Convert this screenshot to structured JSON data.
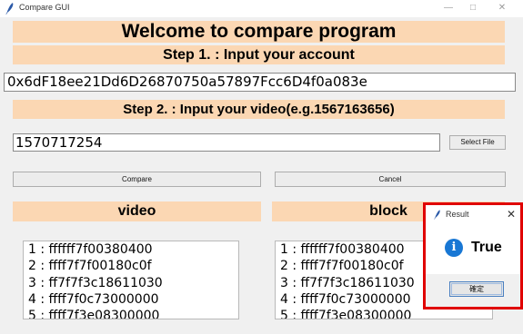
{
  "window": {
    "title": "Compare GUI"
  },
  "header": {
    "heading": "Welcome to compare program"
  },
  "step1": {
    "label": "Step 1. : Input your account",
    "account_value": "0x6dF18ee21Dd6D26870750a57897Fcc6D4f0a083e"
  },
  "step2": {
    "label": "Step 2. : Input your video(e.g.1567163656)",
    "video_value": "1570717254",
    "select_file_label": "Select File"
  },
  "actions": {
    "compare_label": "Compare",
    "cancel_label": "Cancel"
  },
  "columns": {
    "video_label": "video",
    "block_label": "block"
  },
  "video_list": [
    "1 : ffffff7f00380400",
    "2 : ffff7f7f00180c0f",
    "3 : ff7f7f3c18611030",
    "4 : ffff7f0c73000000",
    "5 : ffff7f3e08300000"
  ],
  "block_list": [
    "1 : ffffff7f00380400",
    "2 : ffff7f7f00180c0f",
    "3 : ff7f7f3c18611030",
    "4 : ffff7f0c73000000",
    "5 : ffff7f3e08300000"
  ],
  "dialog": {
    "title": "Result",
    "message": "True",
    "ok_label": "確定"
  },
  "icons": {
    "app": "feather-icon",
    "info": "info-icon",
    "close": "close-icon"
  },
  "colors": {
    "band": "#fbd7b3",
    "highlight_border": "#e00000",
    "info_blue": "#1877d4"
  }
}
